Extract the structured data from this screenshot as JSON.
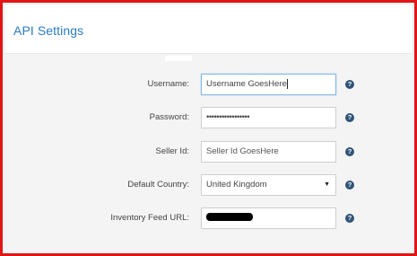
{
  "panel": {
    "title": "API Settings"
  },
  "form": {
    "username": {
      "label": "Username:",
      "value": "Username GoesHere"
    },
    "password": {
      "label": "Password:",
      "value": "•••••••••••••••••"
    },
    "seller_id": {
      "label": "Seller Id:",
      "placeholder": "Seller Id GoesHere"
    },
    "default_country": {
      "label": "Default Country:",
      "selected": "United Kingdom"
    },
    "inventory_feed_url": {
      "label": "Inventory Feed URL:",
      "value_redacted": true
    },
    "help_glyph": "?"
  },
  "icons": {
    "help": "question-circle-icon",
    "dropdown": "triangle-down-icon"
  },
  "colors": {
    "frame_border": "#e01515",
    "title": "#2a7cc0",
    "focus_border": "#82b7e4",
    "help_icon": "#2f5377"
  }
}
